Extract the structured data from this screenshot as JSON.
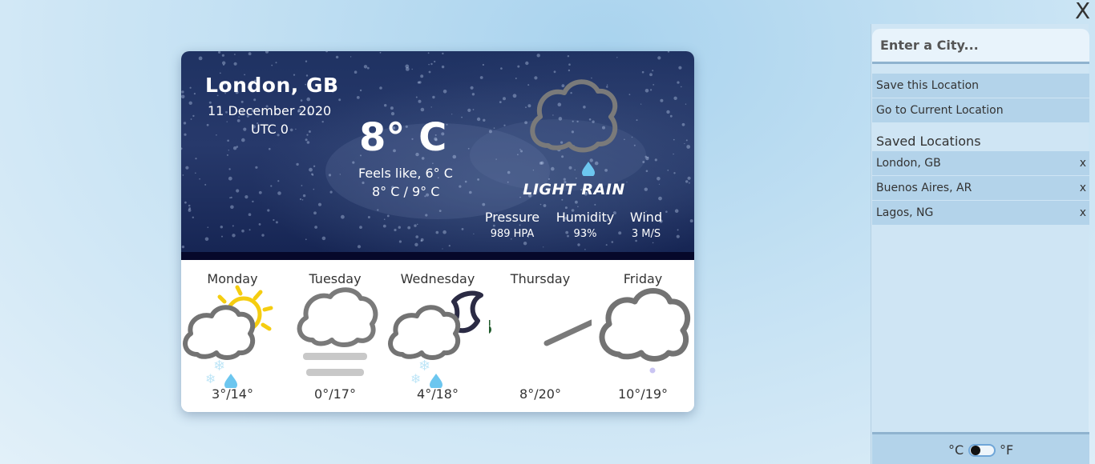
{
  "current": {
    "city": "London, GB",
    "date": "11 December 2020",
    "utc": "UTC 0",
    "temp": "8° C",
    "feels_like": "Feels like, 6° C",
    "range": "8° C / 9° C",
    "condition": "LIGHT RAIN",
    "icon": "cloud-rain-icon",
    "stats": {
      "pressure_label": "Pressure",
      "pressure_value": "989 HPA",
      "humidity_label": "Humidity",
      "humidity_value": "93%",
      "wind_label": "Wind",
      "wind_value": "3 M/S"
    }
  },
  "forecast": [
    {
      "day": "Monday",
      "temps": "3°/14°",
      "icon": "partly-sunny-snow-rain-icon"
    },
    {
      "day": "Tuesday",
      "temps": "0°/17°",
      "icon": "fog-icon"
    },
    {
      "day": "Wednesday",
      "temps": "4°/18°",
      "icon": "cloudy-night-snow-rain-icon"
    },
    {
      "day": "Thursday",
      "temps": "8°/20°",
      "icon": "windy-icon"
    },
    {
      "day": "Friday",
      "temps": "10°/19°",
      "icon": "cloud-icon"
    }
  ],
  "panel": {
    "close_label": "X",
    "search_placeholder": "Enter a City...",
    "save_location": "Save this Location",
    "go_current": "Go to Current Location",
    "saved_title": "Saved Locations",
    "saved_locations": [
      {
        "name": "London, GB",
        "remove": "x"
      },
      {
        "name": "Buenos Aires, AR",
        "remove": "x"
      },
      {
        "name": "Lagos, NG",
        "remove": "x"
      }
    ],
    "unit_c": "°C",
    "unit_f": "°F"
  },
  "colors": {
    "panel_bg": "#cfe5f4",
    "item_bg": "#b3d3ea",
    "header_bg": "#1f3262",
    "rain_drop": "#66c8f0",
    "sun": "#f6cf10",
    "cloud": "#777777"
  }
}
